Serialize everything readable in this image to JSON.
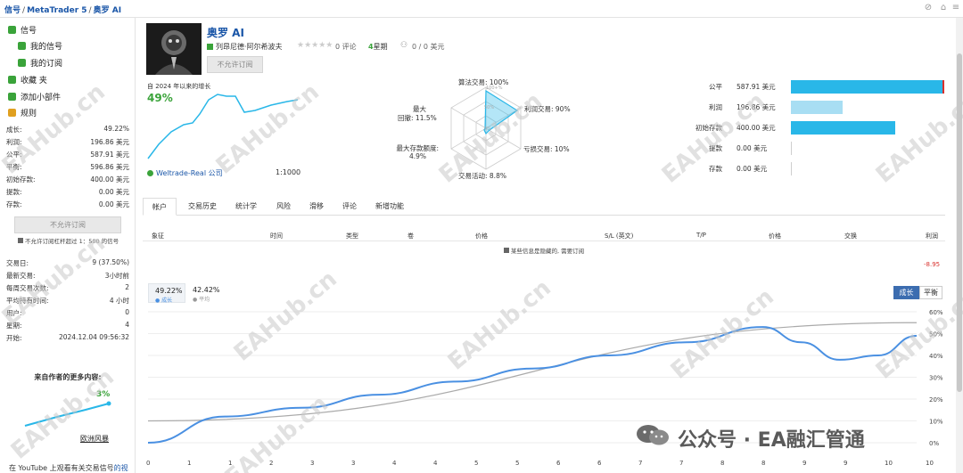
{
  "breadcrumb": [
    "信号",
    "MetaTrader 5",
    "奥罗 AI"
  ],
  "sidebar": {
    "nav": [
      {
        "label": "信号",
        "color": "#3aa33a"
      },
      {
        "label": "我的信号",
        "color": "#3aa33a"
      },
      {
        "label": "我的订阅",
        "color": "#3aa33a"
      },
      {
        "label": "收藏 夹",
        "color": "#3aa33a"
      },
      {
        "label": "添加小部件",
        "color": "#3aa33a"
      },
      {
        "label": "规则",
        "color": "#e0a020"
      }
    ],
    "stats": [
      {
        "label": "成长:",
        "value": "49.22%"
      },
      {
        "label": "利润:",
        "value": "196.86 美元"
      },
      {
        "label": "公平:",
        "value": "587.91 美元"
      },
      {
        "label": "平衡:",
        "value": "596.86 美元"
      },
      {
        "label": "初始存款:",
        "value": "400.00 美元"
      },
      {
        "label": "提款:",
        "value": "0.00 美元"
      },
      {
        "label": "存款:",
        "value": "0.00 美元"
      }
    ],
    "subscribe_button": "不允许订阅",
    "leverage_note": "不允许订阅杠杆超过 1：500 的信号",
    "info": [
      {
        "label": "交易日:",
        "value": "9 (37.50%)"
      },
      {
        "label": "最新交易:",
        "value": "3小时前"
      },
      {
        "label": "每周交易次数:",
        "value": "2"
      },
      {
        "label": "平均持有时间:",
        "value": "4 小时"
      },
      {
        "label": "用户:",
        "value": "0"
      },
      {
        "label": "星期:",
        "value": "4"
      },
      {
        "label": "开始:",
        "value": "2024.12.04 09:56:32"
      }
    ],
    "more_from_author": "来自作者的更多内容:",
    "mini_growth": "3%",
    "mini_name": "欧洲风暴",
    "youtube_prefix": "在 YouTube 上观看有关交易信号",
    "youtube_link": "的视"
  },
  "profile": {
    "name": "奥罗 AI",
    "author": "列昂尼德·阿尔希波夫",
    "reviews": "0 评论",
    "weeks": "4",
    "weeks_label": "星期",
    "subs": "0 / 0 美元",
    "subscribe_button": "不允许订阅",
    "growth_caption": "自 2024 年以来的增长",
    "growth_value": "49%",
    "broker": "Weltrade-Real 公司",
    "leverage": "1:1000"
  },
  "radar": {
    "algo": "算法交易: 100%",
    "profit_trades": "利润交易: 90%",
    "loss_trades": "亏损交易: 10%",
    "activity": "交易活动: 8.8%",
    "max_deposit_load_label": "最大存款额度:",
    "max_deposit_load": "4.9%",
    "max_drawdown_label": "最大",
    "max_drawdown_label2": "回撤:",
    "max_drawdown": "11.5%",
    "ticks": [
      "100+%",
      "50%",
      "0%"
    ]
  },
  "balance_bars": {
    "items": [
      {
        "label": "公平",
        "value": "587.91 美元",
        "amount": 587.91
      },
      {
        "label": "利润",
        "value": "196.86 美元",
        "amount": 196.86
      },
      {
        "label": "初始存款",
        "value": "400.00 美元",
        "amount": 400.0
      },
      {
        "label": "提款",
        "value": "0.00 美元",
        "amount": 0
      },
      {
        "label": "存款",
        "value": "0.00 美元",
        "amount": 0
      }
    ],
    "colors": {
      "main": "#29b7e8",
      "light": "#a8def3",
      "edge": "#d9302c"
    }
  },
  "tabs": [
    "帐户",
    "交易历史",
    "统计学",
    "风险",
    "滑移",
    "评论",
    "新增功能"
  ],
  "table": {
    "headers": [
      "象征",
      "时间",
      "类型",
      "卷",
      "价格",
      "S/L (英文)",
      "T/P",
      "价格",
      "交换",
      "利润"
    ],
    "hidden_note": "某些信息是隐藏的, 需要订阅",
    "profit_value": "-8.95"
  },
  "growth_chart": {
    "growth_value": "49.22%",
    "growth_label": "成长",
    "avg_value": "42.42%",
    "avg_label": "平均",
    "toggle": [
      "成长",
      "平衡"
    ],
    "x_ticks": [
      "0",
      "1",
      "1",
      "2",
      "3",
      "3",
      "4",
      "4",
      "5",
      "5",
      "6",
      "6",
      "7",
      "7",
      "8",
      "8",
      "9",
      "9",
      "10",
      "10"
    ],
    "y_ticks": [
      "60%",
      "50%",
      "40%",
      "30%",
      "20%",
      "10%",
      "0%"
    ]
  },
  "chart_data": {
    "type": "line",
    "y_range": [
      0,
      60
    ],
    "series": [
      {
        "name": "成长",
        "color": "#4a90e2",
        "x": [
          0,
          1,
          2,
          3,
          4,
          5,
          6,
          7,
          8,
          8.5,
          9,
          9.5,
          10
        ],
        "y": [
          0,
          12,
          16,
          22,
          28,
          34,
          40,
          46,
          53,
          46,
          38,
          40,
          49
        ]
      },
      {
        "name": "平均",
        "color": "#aaaaaa",
        "x": [
          0,
          10
        ],
        "y": [
          10,
          55
        ]
      }
    ]
  },
  "watermarks": [
    "EAHub.cn",
    "EAHub.cn",
    "EAHub.cn",
    "EAHub.cn",
    "EAHub.cn",
    "EAHub.cn",
    "EAHub.cn",
    "EAHub.cn",
    "EAHub.cn",
    "EAHub.cn",
    "EAHub.cn",
    "EAHub.cn"
  ],
  "footer_brand": "公众号 · EA融汇管通"
}
